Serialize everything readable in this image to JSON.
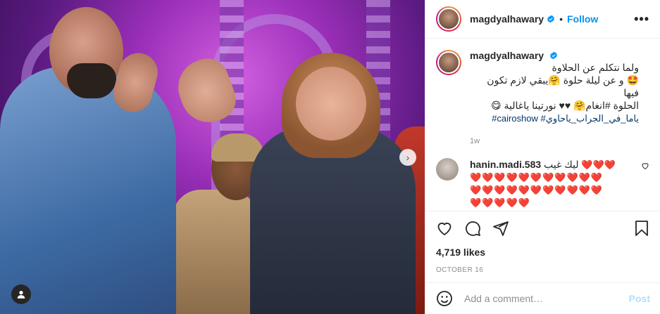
{
  "post": {
    "author": "magdyalhawary",
    "follow_label": "Follow",
    "more_label": "•••",
    "caption_lines": [
      "ولما نتكلم عن الحلاوة",
      "🤩 و عن ليلة حلوة 🤗يبقي لازم تكون فيها",
      "الحلوة #انغام🤗 ♥♥ نورتينا ياغالية 😋"
    ],
    "hashtags": "#cairoshow #ياما_في_الجراب_ياحاوي",
    "time_ago": "1w"
  },
  "comment": {
    "user": "hanin.madi.583",
    "text": "ليك غيب",
    "hearts_line1": "❤️❤️❤️",
    "hearts_line2": "❤️❤️❤️❤️❤️❤️❤️❤️❤️❤️❤️",
    "hearts_line3": "❤️❤️❤️❤️❤️❤️❤️❤️❤️❤️❤️",
    "hearts_line4": "❤️❤️❤️❤️❤️"
  },
  "stats": {
    "likes": "4,719 likes",
    "date": "OCTOBER 16"
  },
  "add_comment": {
    "placeholder": "Add a comment…",
    "post_label": "Post"
  },
  "photo": {
    "carousel_next": "›"
  },
  "colors": {
    "accent": "#0095f6",
    "heart": "#e0245e",
    "post_disabled": "#b2dffc"
  }
}
